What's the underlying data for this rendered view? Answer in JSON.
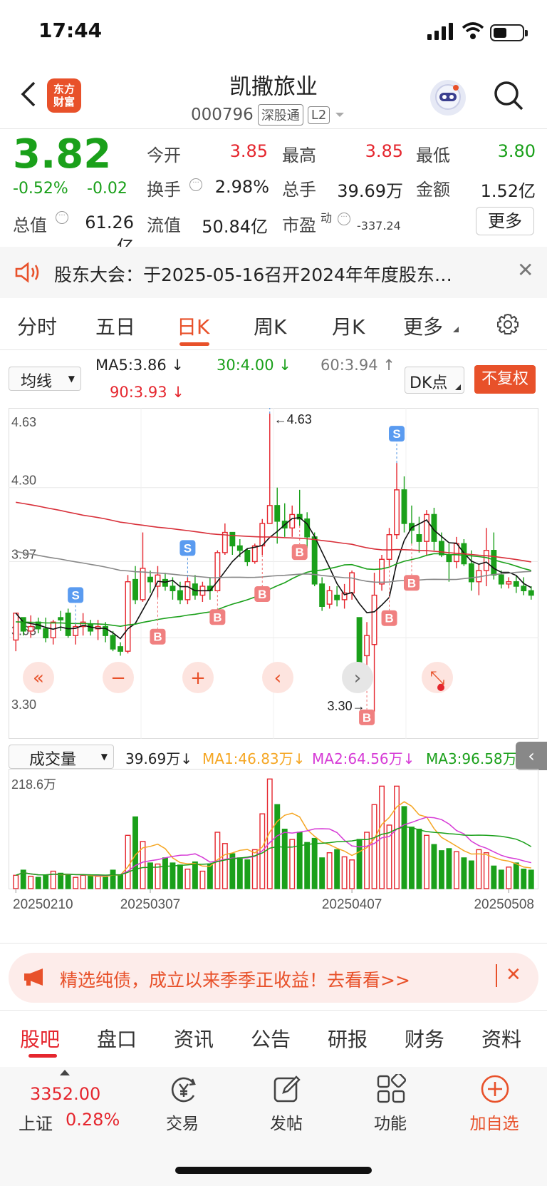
{
  "status": {
    "time": "17:44"
  },
  "header": {
    "logo_text": "东方\n财富",
    "title": "凯撒旅业",
    "code": "000796",
    "tags": [
      "深股通",
      "L2"
    ]
  },
  "quote": {
    "price": "3.82",
    "change_pct": "-0.52%",
    "change_amt": "-0.02",
    "open_label": "今开",
    "open": "3.85",
    "high_label": "最高",
    "high": "3.85",
    "low_label": "最低",
    "low": "3.80",
    "turnover_label": "换手",
    "turnover": "2.98%",
    "volume_label": "总手",
    "volume": "39.69万",
    "amount_label": "金额",
    "amount": "1.52亿",
    "mktcap_label": "总值",
    "mktcap": "61.26亿",
    "float_label": "流值",
    "float": "50.84亿",
    "pe_label": "市盈",
    "pe_sup": "动",
    "pe": "-337.24",
    "more": "更多"
  },
  "notice": {
    "text": "股东大会：于2025-05-16召开2024年年度股东…"
  },
  "period_tabs": [
    "分时",
    "五日",
    "日K",
    "周K",
    "月K",
    "更多"
  ],
  "active_period": "日K",
  "ma_row": {
    "select": "均线",
    "ma5": "MA5:3.86",
    "ma30": "30:4.00",
    "ma60": "60:3.94",
    "ma90": "90:3.93",
    "dk": "DK点",
    "fq": "不复权"
  },
  "vol_row": {
    "select": "成交量",
    "vol": "39.69万",
    "ma1": "MA1:46.83万",
    "ma2": "MA2:64.56万",
    "ma3": "MA3:96.58万"
  },
  "chart_data": {
    "type": "candlestick",
    "price_axis_labels": [
      "4.63",
      "4.30",
      "3.97",
      "3.63",
      "3.30"
    ],
    "ylim": [
      3.3,
      4.63
    ],
    "max_annotation": "4.63",
    "min_annotation": "3.30",
    "volume_axis_label": "218.6万",
    "x_tick_labels": [
      "20250210",
      "20250307",
      "20250407",
      "20250508"
    ],
    "signals": [
      "S",
      "B",
      "S",
      "B",
      "B",
      "S",
      "B",
      "B",
      "B",
      "S",
      "B"
    ],
    "candles": [
      [
        3.62,
        3.74,
        3.57,
        3.74,
        0.13
      ],
      [
        3.72,
        3.72,
        3.64,
        3.66,
        0.18
      ],
      [
        3.66,
        3.73,
        3.63,
        3.68,
        0.12
      ],
      [
        3.7,
        3.72,
        3.65,
        3.67,
        0.11
      ],
      [
        3.67,
        3.72,
        3.61,
        3.63,
        0.13
      ],
      [
        3.63,
        3.71,
        3.6,
        3.7,
        0.17
      ],
      [
        3.72,
        3.75,
        3.66,
        3.71,
        0.15
      ],
      [
        3.74,
        3.76,
        3.63,
        3.64,
        0.13
      ],
      [
        3.64,
        3.69,
        3.6,
        3.68,
        0.11
      ],
      [
        3.68,
        3.74,
        3.64,
        3.7,
        0.13
      ],
      [
        3.69,
        3.71,
        3.64,
        3.66,
        0.12
      ],
      [
        3.67,
        3.71,
        3.62,
        3.68,
        0.12
      ],
      [
        3.68,
        3.7,
        3.61,
        3.64,
        0.11
      ],
      [
        3.64,
        3.66,
        3.57,
        3.58,
        0.18
      ],
      [
        3.59,
        3.61,
        3.55,
        3.57,
        0.13
      ],
      [
        3.57,
        3.91,
        3.56,
        3.88,
        0.52
      ],
      [
        3.89,
        3.95,
        3.78,
        3.8,
        0.7
      ],
      [
        3.8,
        4.1,
        3.79,
        3.94,
        0.46
      ],
      [
        3.9,
        3.93,
        3.83,
        3.88,
        0.25
      ],
      [
        3.86,
        3.95,
        3.81,
        3.91,
        0.24
      ],
      [
        3.89,
        3.92,
        3.84,
        3.86,
        0.3
      ],
      [
        3.86,
        3.9,
        3.8,
        3.84,
        0.25
      ],
      [
        3.84,
        3.88,
        3.78,
        3.8,
        0.23
      ],
      [
        3.8,
        3.9,
        3.78,
        3.88,
        0.19
      ],
      [
        3.87,
        3.91,
        3.8,
        3.82,
        0.26
      ],
      [
        3.82,
        3.88,
        3.79,
        3.86,
        0.17
      ],
      [
        3.86,
        3.9,
        3.8,
        3.84,
        0.24
      ],
      [
        3.84,
        4.02,
        3.84,
        4.01,
        0.55
      ],
      [
        4.01,
        4.14,
        4.0,
        4.1,
        0.44
      ],
      [
        4.1,
        4.1,
        4.0,
        4.04,
        0.34
      ],
      [
        4.04,
        4.07,
        3.99,
        4.02,
        0.3
      ],
      [
        4.02,
        4.03,
        3.95,
        3.97,
        0.28
      ],
      [
        3.97,
        4.05,
        3.96,
        4.04,
        0.38
      ],
      [
        4.04,
        4.16,
        4.0,
        4.14,
        0.73
      ],
      [
        4.14,
        4.63,
        4.14,
        4.22,
        1.07
      ],
      [
        4.22,
        4.3,
        4.05,
        4.15,
        0.82
      ],
      [
        4.15,
        4.23,
        4.08,
        4.12,
        0.58
      ],
      [
        4.12,
        4.22,
        4.08,
        4.18,
        0.48
      ],
      [
        4.18,
        4.29,
        4.13,
        4.16,
        0.55
      ],
      [
        4.16,
        4.19,
        4.03,
        4.08,
        0.45
      ],
      [
        4.08,
        4.1,
        3.86,
        3.87,
        0.49
      ],
      [
        3.87,
        3.9,
        3.75,
        3.77,
        0.3
      ],
      [
        3.78,
        3.86,
        3.76,
        3.84,
        0.35
      ],
      [
        3.82,
        3.86,
        3.77,
        3.8,
        0.38
      ],
      [
        3.8,
        3.87,
        3.76,
        3.83,
        0.31
      ],
      [
        3.83,
        3.93,
        3.8,
        3.92,
        0.28
      ],
      [
        3.72,
        3.72,
        3.5,
        3.52,
        0.48
      ],
      [
        3.55,
        3.7,
        3.45,
        3.64,
        0.55
      ],
      [
        3.6,
        3.92,
        3.3,
        3.82,
        0.82
      ],
      [
        3.87,
        4.0,
        3.84,
        3.98,
        1.0
      ],
      [
        3.98,
        4.12,
        3.95,
        4.09,
        0.62
      ],
      [
        4.09,
        4.41,
        4.07,
        4.29,
        1.0
      ],
      [
        4.29,
        4.35,
        4.1,
        4.14,
        0.8
      ],
      [
        4.14,
        4.22,
        4.05,
        4.11,
        0.6
      ],
      [
        4.09,
        4.17,
        4.01,
        4.06,
        0.58
      ],
      [
        4.06,
        4.2,
        4.0,
        4.18,
        0.52
      ],
      [
        4.18,
        4.21,
        4.02,
        4.06,
        0.43
      ],
      [
        4.06,
        4.1,
        3.99,
        4.0,
        0.37
      ],
      [
        4.0,
        4.05,
        3.88,
        3.97,
        0.39
      ],
      [
        3.97,
        4.08,
        3.94,
        4.05,
        0.36
      ],
      [
        4.05,
        4.07,
        3.95,
        3.96,
        0.3
      ],
      [
        3.96,
        4.02,
        3.84,
        3.88,
        0.27
      ],
      [
        3.88,
        3.96,
        3.82,
        3.93,
        0.38
      ],
      [
        3.93,
        4.12,
        3.86,
        4.02,
        0.35
      ],
      [
        4.02,
        4.1,
        3.89,
        3.91,
        0.22
      ],
      [
        3.91,
        3.93,
        3.85,
        3.87,
        0.18
      ],
      [
        3.87,
        3.9,
        3.85,
        3.88,
        0.21
      ],
      [
        3.88,
        3.91,
        3.83,
        3.86,
        0.25
      ],
      [
        3.86,
        3.9,
        3.82,
        3.84,
        0.19
      ],
      [
        3.84,
        3.86,
        3.8,
        3.82,
        0.18
      ]
    ]
  },
  "chart_buttons": [
    "«",
    "−",
    "+",
    "‹",
    "›",
    "⤡"
  ],
  "banner": {
    "text": "精选纯债，成立以来季季正收益！去看看>>"
  },
  "bottom_tabs": [
    "股吧",
    "盘口",
    "资讯",
    "公告",
    "研报",
    "财务",
    "资料"
  ],
  "navbar": {
    "index_value": "3352.00",
    "index_name": "上证",
    "index_pct": "0.28%",
    "items": [
      "交易",
      "发帖",
      "功能",
      "加自选"
    ]
  },
  "colors": {
    "up": "#e5262e",
    "down": "#1aa01a",
    "accent": "#e8512a"
  }
}
